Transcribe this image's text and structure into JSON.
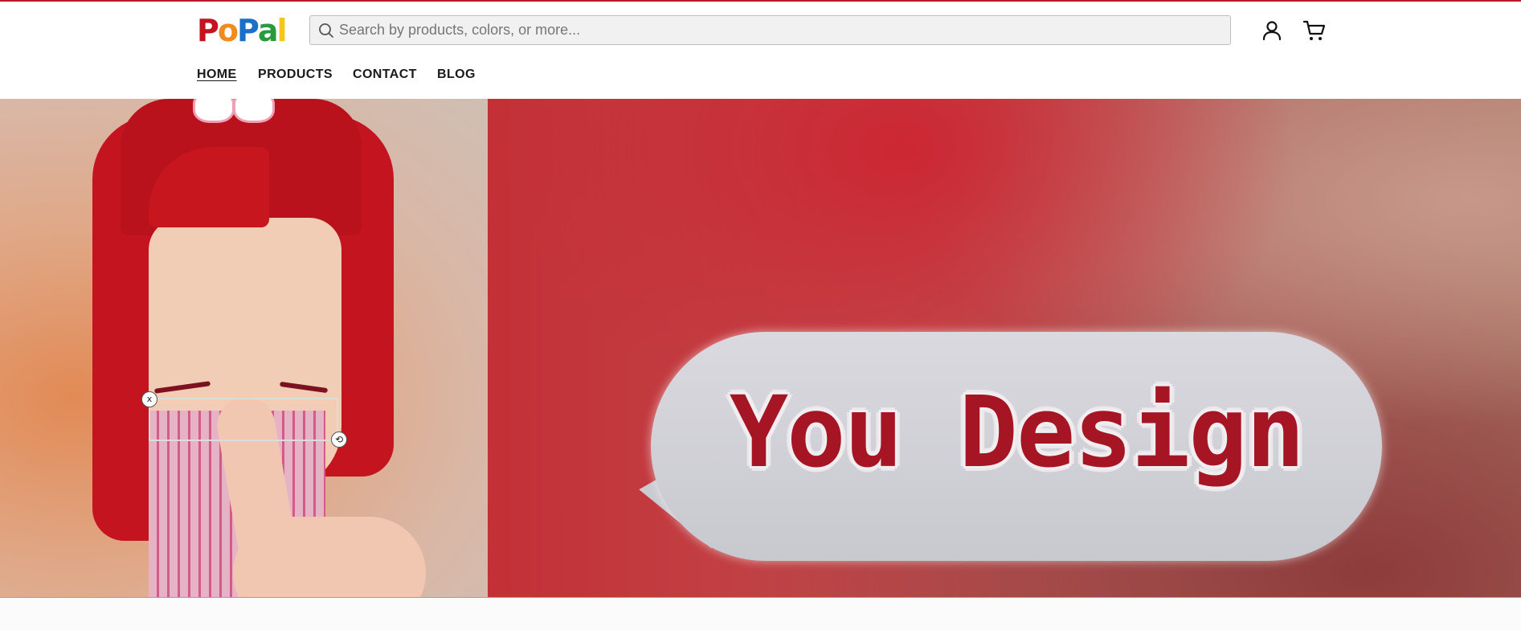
{
  "brand": {
    "name": "PoPal",
    "logo_letters": [
      "P",
      "o",
      "P",
      "a",
      "l"
    ],
    "logo_colors": [
      "#c4141f",
      "#f28a1c",
      "#1a6fc9",
      "#2a9b3c",
      "#f5c518"
    ]
  },
  "search": {
    "placeholder": "Search by products, colors, or more..."
  },
  "header_icons": {
    "account": "user-icon",
    "cart": "cart-icon"
  },
  "nav": {
    "items": [
      {
        "label": "HOME",
        "active": true
      },
      {
        "label": "PRODUCTS",
        "active": false
      },
      {
        "label": "CONTACT",
        "active": false
      },
      {
        "label": "BLOG",
        "active": false
      }
    ]
  },
  "hero": {
    "bubble_text": "You Design",
    "handle_close": "x",
    "handle_rotate": "⟲"
  },
  "colors": {
    "accent": "#b81c2a",
    "hero_text": "#a51524"
  }
}
